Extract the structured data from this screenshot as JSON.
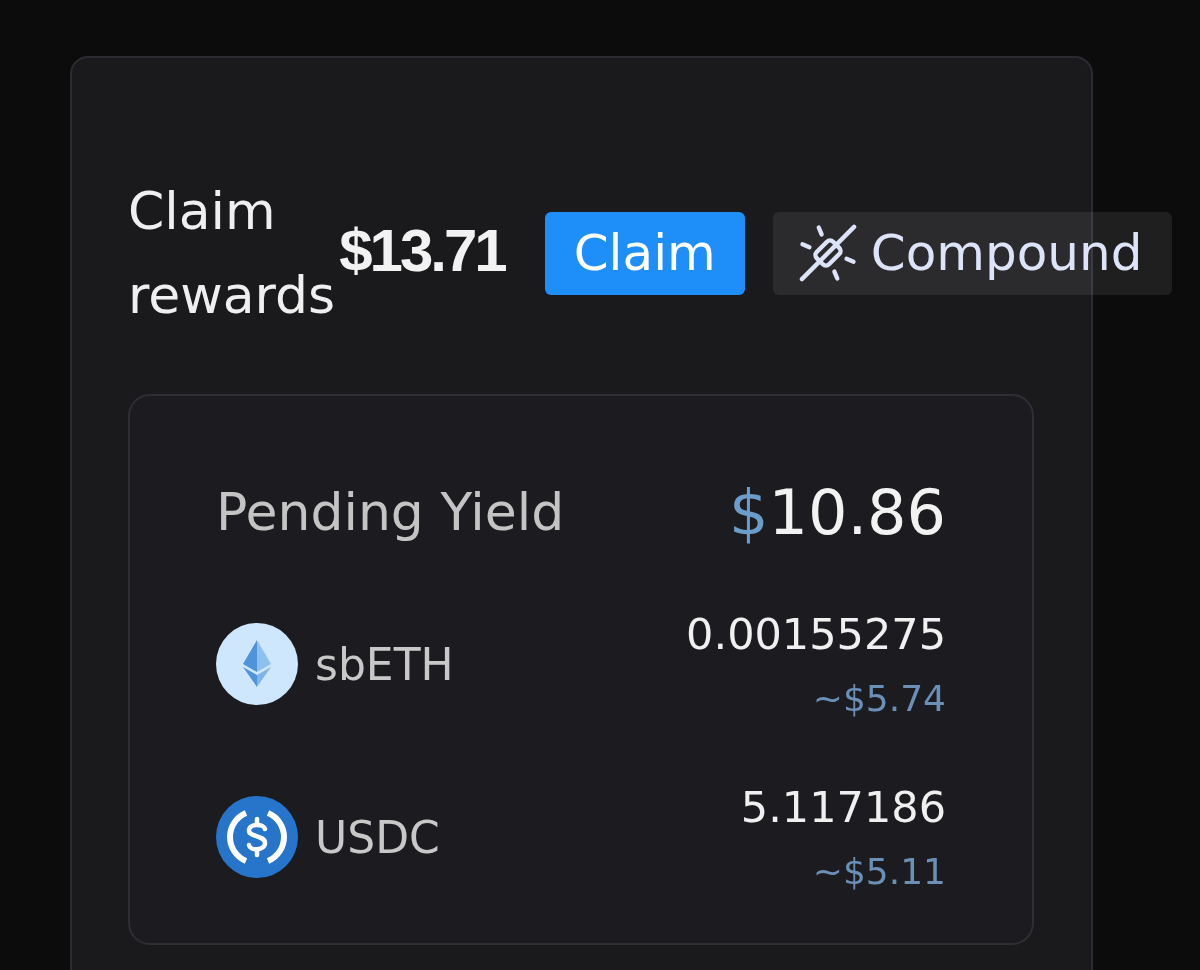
{
  "header": {
    "title": "Claim rewards",
    "total": "$13.71",
    "actions": [
      {
        "label": "Claim",
        "kind": "primary"
      },
      {
        "label": "Compound",
        "kind": "secondary"
      }
    ]
  },
  "pending": {
    "label": "Pending Yield",
    "currency": "$",
    "amount": "10.86"
  },
  "tokens": [
    {
      "symbol": "sbETH",
      "kind": "eth",
      "amount": "0.00155275",
      "usd": "~$5.74"
    },
    {
      "symbol": "USDC",
      "kind": "usdc",
      "amount": "5.117186",
      "usd": "~$5.11"
    }
  ]
}
